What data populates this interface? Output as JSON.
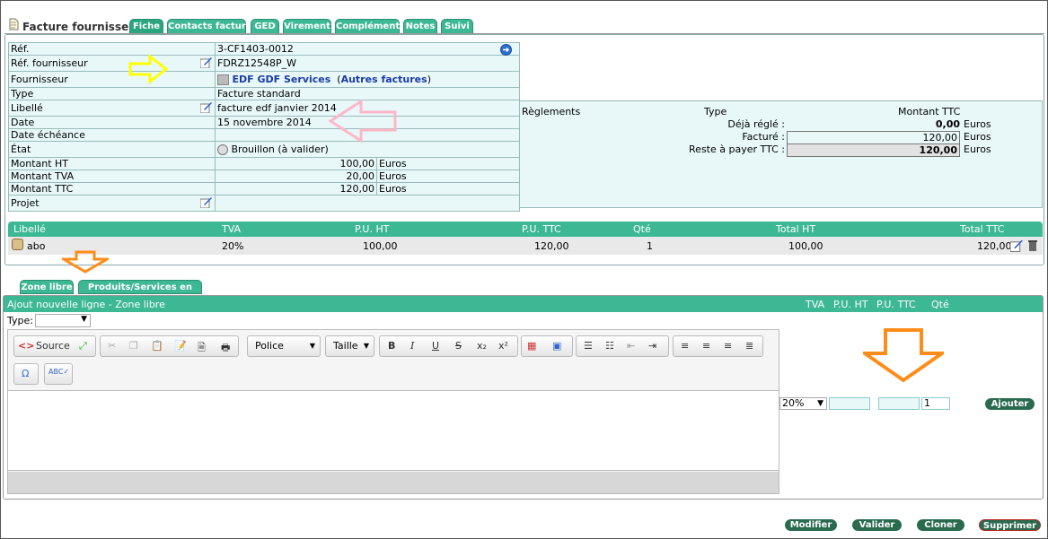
{
  "header": {
    "title": "Facture fournisseur",
    "tabs": [
      "Fiche",
      "Contacts facture",
      "GED",
      "Virement",
      "Complément",
      "Notes",
      "Suivi"
    ]
  },
  "fiche": {
    "ref_label": "Réf.",
    "ref_value": "3-CF1403-0012",
    "ref_fourn_label": "Réf. fournisseur",
    "ref_fourn_value": "FDRZ12548P_W",
    "fournisseur_label": "Fournisseur",
    "fournisseur_value": "EDF GDF Services",
    "autres_factures": "Autres factures",
    "type_label": "Type",
    "type_value": "Facture standard",
    "libelle_label": "Libellé",
    "libelle_value": "facture edf janvier 2014",
    "date_label": "Date",
    "date_value": "15 novembre 2014",
    "echeance_label": "Date échéance",
    "etat_label": "État",
    "etat_value": "Brouillon (à valider)",
    "ht_label": "Montant HT",
    "ht_value": "100,00",
    "tva_label": "Montant TVA",
    "tva_value": "20,00",
    "ttc_label": "Montant TTC",
    "ttc_value": "120,00",
    "currency": "Euros",
    "projet_label": "Projet"
  },
  "reglements": {
    "title": "Règlements",
    "type_col": "Type",
    "montant_col": "Montant TTC",
    "deja_label": "Déjà réglé :",
    "deja_value": "0,00",
    "facture_label": "Facturé :",
    "facture_value": "120,00",
    "reste_label": "Reste à payer TTC :",
    "reste_value": "120,00",
    "currency": "Euros"
  },
  "lines": {
    "headers": [
      "Libellé",
      "TVA",
      "P.U. HT",
      "P.U. TTC",
      "Qté",
      "Total HT",
      "Total TTC"
    ],
    "rows": [
      {
        "libelle": "abo",
        "tva": "20%",
        "pu_ht": "100,00",
        "pu_ttc": "120,00",
        "qte": "1",
        "total_ht": "100,00",
        "total_ttc": "120,00"
      }
    ]
  },
  "add_tabs": [
    "Zone libre",
    "Produits/Services en vente"
  ],
  "add_line": {
    "title": "Ajout nouvelle ligne - Zone libre",
    "cols": [
      "TVA",
      "P.U. HT",
      "P.U. TTC",
      "Qté"
    ],
    "type_label": "Type:",
    "tva_value": "20%",
    "qty_value": "1",
    "add_button": "Ajouter"
  },
  "editor": {
    "source_label": "Source",
    "font_label": "Police",
    "size_label": "Taille"
  },
  "actions": [
    "Modifier",
    "Valider",
    "Cloner",
    "Supprimer"
  ]
}
